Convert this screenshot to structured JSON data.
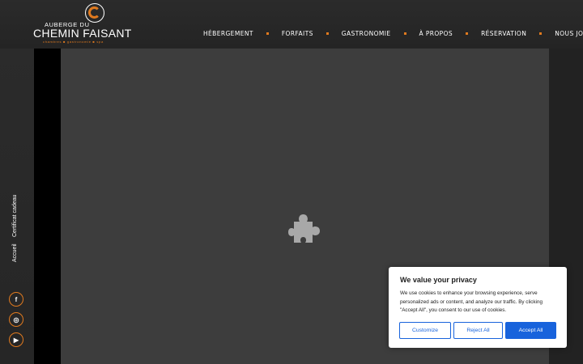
{
  "brand": {
    "line1": "AUBERGE DU",
    "line2": "CHEMIN FAISANT",
    "tagline": "chambres ■ gastronomie ■ spa",
    "accent": "#e07a1f"
  },
  "nav": {
    "items": [
      {
        "label": "HÉBERGEMENT"
      },
      {
        "label": "FORFAITS"
      },
      {
        "label": "GASTRONOMIE"
      },
      {
        "label": "À PROPOS"
      },
      {
        "label": "RÉSERVATION"
      },
      {
        "label": "NOUS JOINDRE"
      }
    ]
  },
  "side": {
    "links": [
      {
        "label": "Certificat cadeau"
      },
      {
        "label": "Accueil"
      }
    ],
    "social": [
      {
        "icon": "facebook-icon",
        "glyph": "f"
      },
      {
        "icon": "instagram-icon",
        "glyph": "◎"
      },
      {
        "icon": "youtube-icon",
        "glyph": "▶"
      }
    ]
  },
  "video": {
    "placeholder_icon": "puzzle-plugin-icon"
  },
  "cookie": {
    "title": "We value your privacy",
    "text": "We use cookies to enhance your browsing experience, serve personalized ads or content, and analyze our traffic. By clicking \"Accept All\", you consent to our use of cookies.",
    "customize": "Customize",
    "reject": "Reject All",
    "accept": "Accept All",
    "button_color": "#1863dc"
  }
}
